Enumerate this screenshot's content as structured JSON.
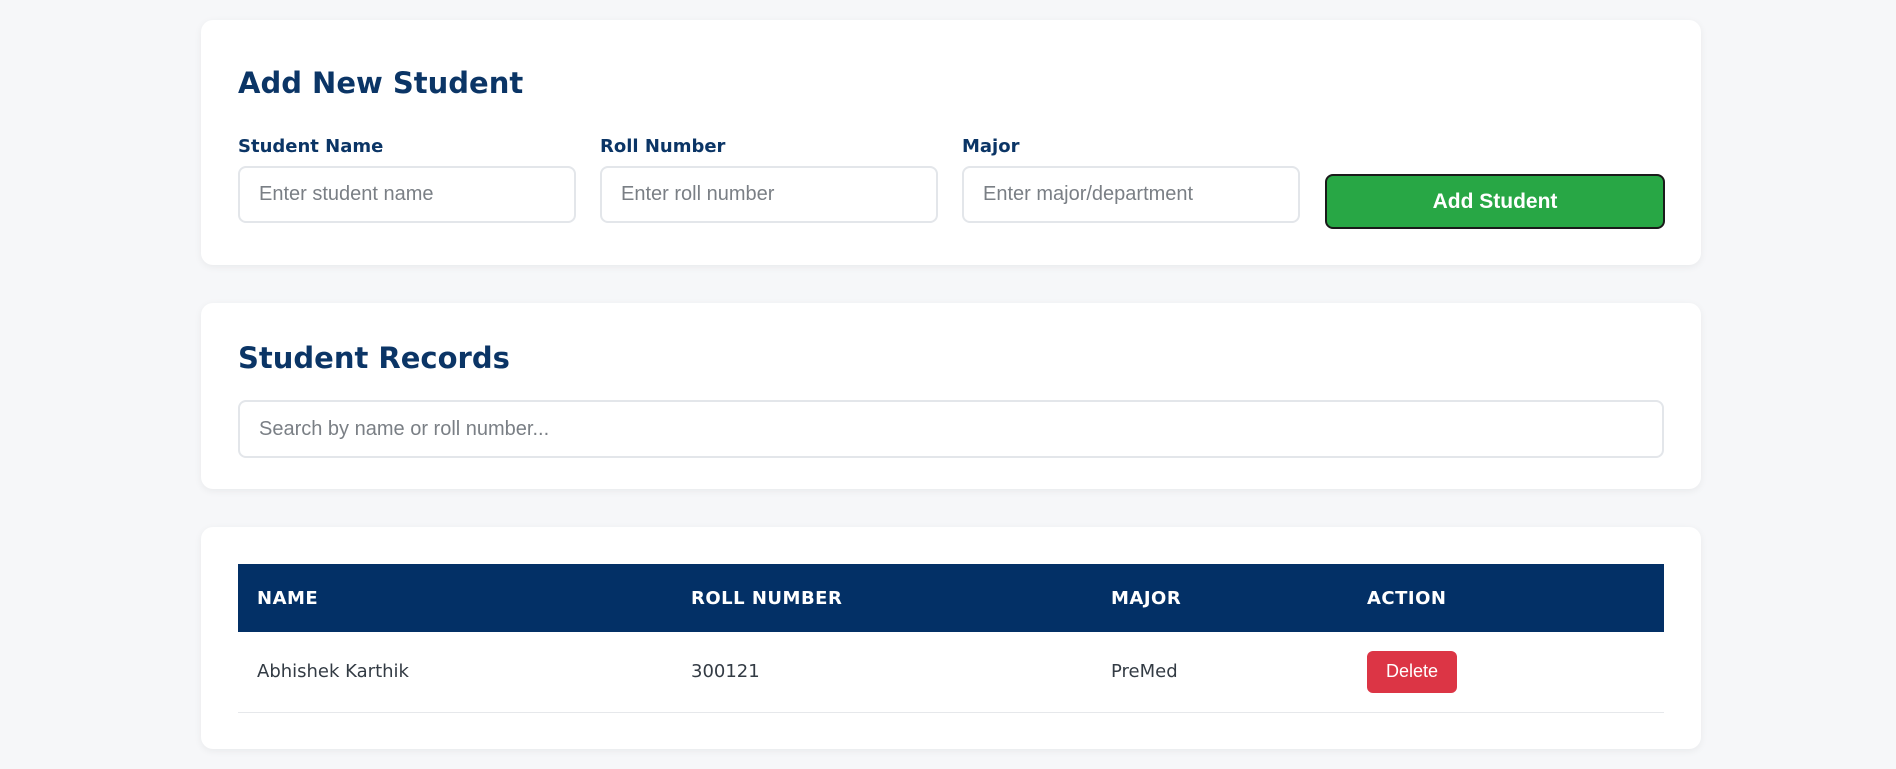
{
  "add_form": {
    "title": "Add New Student",
    "name_label": "Student Name",
    "name_placeholder": "Enter student name",
    "name_value": "",
    "roll_label": "Roll Number",
    "roll_placeholder": "Enter roll number",
    "roll_value": "",
    "major_label": "Major",
    "major_placeholder": "Enter major/department",
    "major_value": "",
    "submit_label": "Add Student"
  },
  "records": {
    "title": "Student Records",
    "search_placeholder": "Search by name or roll number...",
    "search_value": ""
  },
  "table": {
    "headers": [
      "NAME",
      "ROLL NUMBER",
      "MAJOR",
      "ACTION"
    ],
    "rows": [
      {
        "name": "Abhishek Karthik",
        "roll": "300121",
        "major": "PreMed",
        "action_label": "Delete"
      }
    ]
  },
  "colors": {
    "brand": "#0b3566",
    "table_header_bg": "#033066",
    "add_button": "#28a745",
    "delete_button": "#dc3545",
    "page_bg": "#f6f7f9"
  }
}
